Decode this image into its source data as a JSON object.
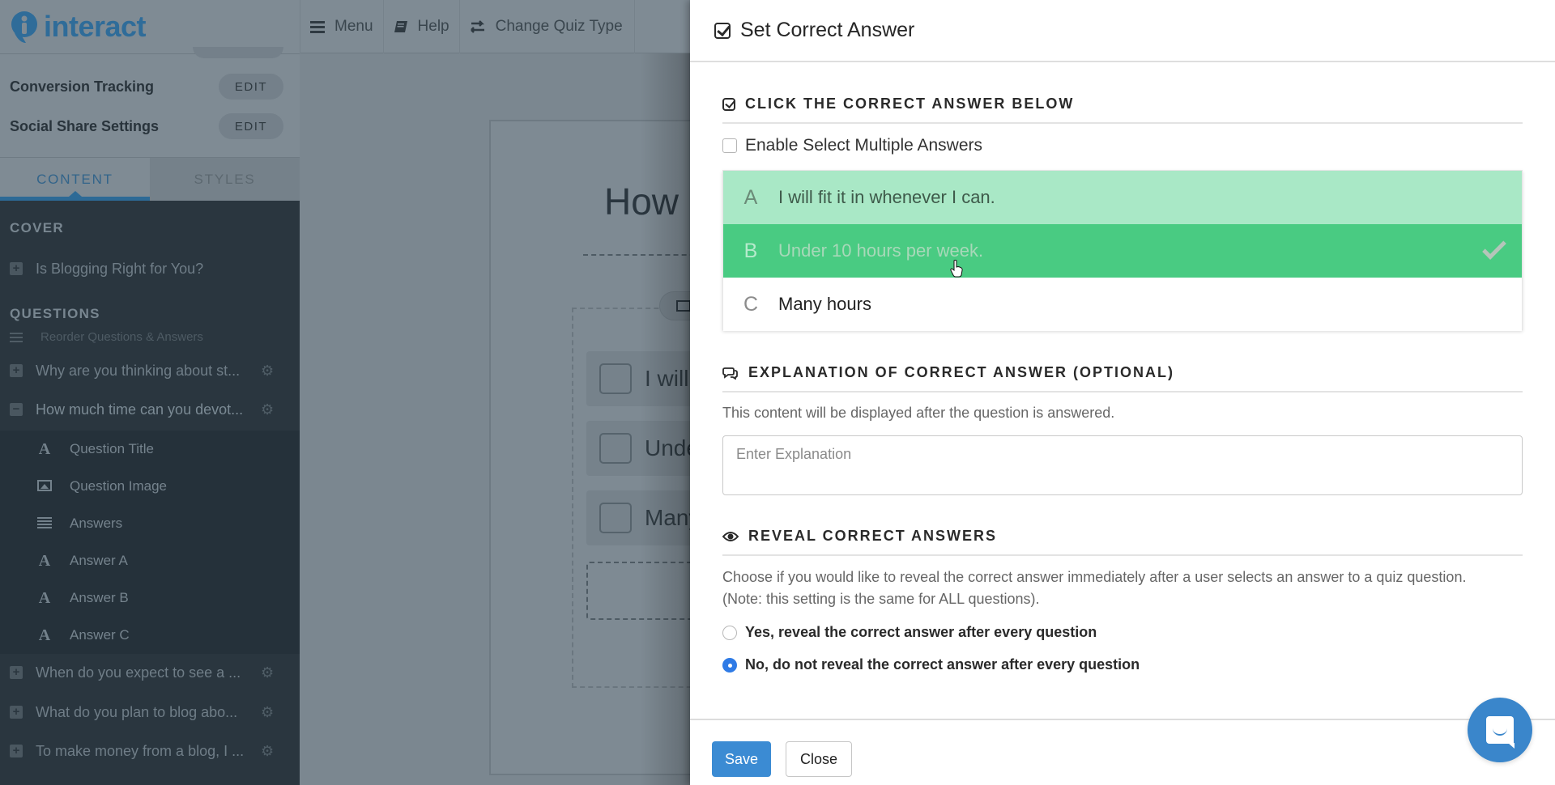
{
  "app": {
    "logo_text": "interact"
  },
  "topnav": {
    "items": [
      {
        "label": "Menu",
        "icon": "hamburger-icon"
      },
      {
        "label": "Help",
        "icon": "book-icon"
      },
      {
        "label": "Change Quiz Type",
        "icon": "swap-arrows-icon"
      }
    ]
  },
  "sidebar": {
    "settings": [
      {
        "label": "Conversion Tracking",
        "action": "EDIT"
      },
      {
        "label": "Social Share Settings",
        "action": "EDIT"
      }
    ],
    "tabs": [
      {
        "label": "CONTENT",
        "active": true
      },
      {
        "label": "STYLES",
        "active": false
      }
    ],
    "cover_heading": "COVER",
    "cover_item": "Is Blogging Right for You?",
    "questions_heading": "QUESTIONS",
    "reorder_label": "Reorder Questions & Answers",
    "questions": [
      {
        "label": "Why are you thinking about st...",
        "expanded": false
      },
      {
        "label": "How much time can you devot...",
        "expanded": true
      },
      {
        "label": "When do you expect to see a ...",
        "expanded": false
      },
      {
        "label": "What do you plan to blog abo...",
        "expanded": false
      },
      {
        "label": "To make money from a blog, I ...",
        "expanded": false
      }
    ],
    "sub_items": [
      {
        "label": "Question Title",
        "icon": "text-a-icon"
      },
      {
        "label": "Question Image",
        "icon": "image-icon"
      },
      {
        "label": "Answers",
        "icon": "list-icon"
      },
      {
        "label": "Answer A",
        "icon": "text-a-icon"
      },
      {
        "label": "Answer B",
        "icon": "text-a-icon"
      },
      {
        "label": "Answer C",
        "icon": "text-a-icon"
      }
    ]
  },
  "canvas": {
    "question_title_partial": "How m",
    "answers_partial": [
      "I will",
      "Unde",
      "Many"
    ]
  },
  "modal": {
    "title": "Set Correct Answer",
    "click_section": {
      "heading": "CLICK THE CORRECT ANSWER BELOW",
      "enable_multiple_label": "Enable Select Multiple Answers",
      "enable_multiple_checked": false,
      "answers": [
        {
          "letter": "A",
          "text": "I will fit it in whenever I can.",
          "state": "hover"
        },
        {
          "letter": "B",
          "text": "Under 10 hours per week.",
          "state": "correct"
        },
        {
          "letter": "C",
          "text": "Many hours",
          "state": "normal"
        }
      ]
    },
    "explanation_section": {
      "heading": "EXPLANATION OF CORRECT ANSWER (OPTIONAL)",
      "description": "This content will be displayed after the question is answered.",
      "placeholder": "Enter Explanation",
      "value": ""
    },
    "reveal_section": {
      "heading": "REVEAL CORRECT ANSWERS",
      "description_line1": "Choose if you would like to reveal the correct answer immediately after a user selects an answer to a quiz question.",
      "description_line2": "(Note: this setting is the same for ALL questions).",
      "options": [
        {
          "label": "Yes, reveal the correct answer after every question",
          "selected": false
        },
        {
          "label": "No, do not reveal the correct answer after every question",
          "selected": true
        }
      ]
    },
    "footer": {
      "save_label": "Save",
      "close_label": "Close"
    }
  },
  "colors": {
    "brand_blue": "#2f6c99",
    "correct_green": "#49cb82",
    "hover_green": "#a9e8c6",
    "save_blue": "#3b8bd3",
    "radio_blue": "#2f7be6",
    "chat_blue": "#3a86cb"
  }
}
